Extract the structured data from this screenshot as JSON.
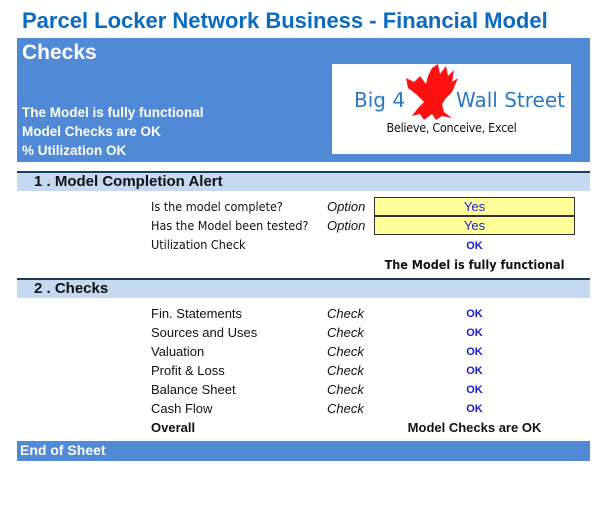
{
  "title": "Parcel Locker Network Business - Financial Model",
  "banner": {
    "sheet_name": "Checks",
    "status_lines": [
      "The Model is fully functional",
      "Model Checks are OK",
      "% Utilization OK"
    ],
    "logo": {
      "brand_left": "Big 4",
      "brand_right": "Wall Street",
      "tagline": "Believe, Conceive, Excel",
      "icon": "eagle-icon"
    }
  },
  "section1": {
    "header": "1 . Model Completion Alert",
    "rows": [
      {
        "label": "Is the model complete?",
        "type": "Option",
        "value": "Yes"
      },
      {
        "label": "Has the Model been tested?",
        "type": "Option",
        "value": "Yes"
      },
      {
        "label": "Utilization Check",
        "type": "",
        "value": "OK"
      }
    ],
    "summary": "The Model is fully functional"
  },
  "section2": {
    "header": "2 . Checks",
    "rows": [
      {
        "label": "Fin. Statements",
        "type": "Check",
        "value": "OK"
      },
      {
        "label": "Sources and Uses",
        "type": "Check",
        "value": "OK"
      },
      {
        "label": "Valuation",
        "type": "Check",
        "value": "OK"
      },
      {
        "label": "Profit & Loss",
        "type": "Check",
        "value": "OK"
      },
      {
        "label": "Balance Sheet",
        "type": "Check",
        "value": "OK"
      },
      {
        "label": "Cash Flow",
        "type": "Check",
        "value": "OK"
      }
    ],
    "overall_label": "Overall",
    "overall_value": "Model Checks are OK"
  },
  "footer": "End of Sheet",
  "colors": {
    "title": "#0a6bbf",
    "banner": "#5089d5",
    "section_header": "#c5d9f1",
    "input_cell": "#ffff99",
    "ok_text": "#1a1acc",
    "logo_red": "#ff1010"
  }
}
